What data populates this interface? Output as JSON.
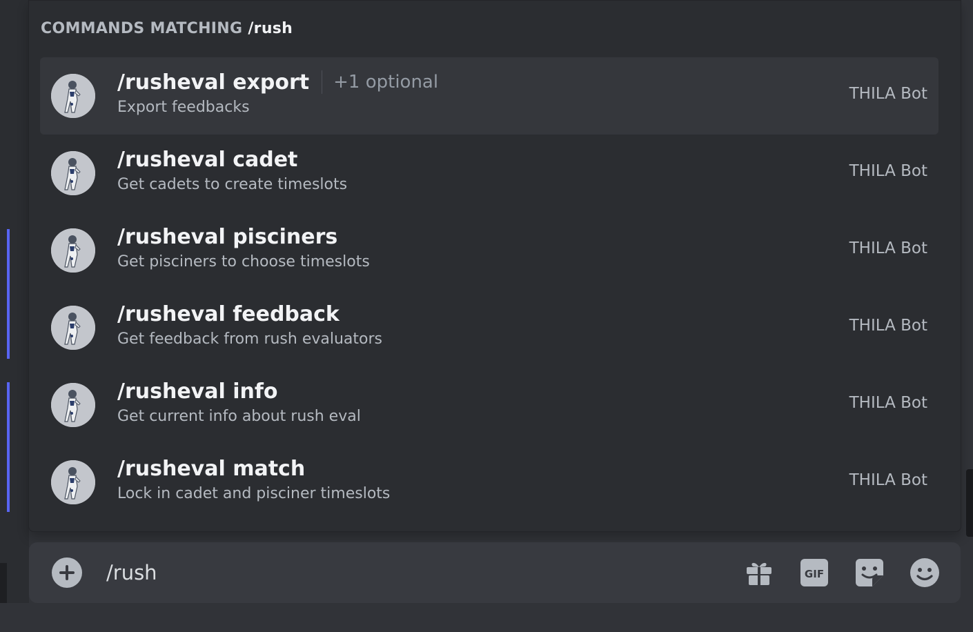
{
  "autocomplete": {
    "header_prefix": "COMMANDS MATCHING",
    "header_query": "/rush",
    "commands": [
      {
        "name": "/rusheval export",
        "optional": "+1 optional",
        "description": "Export feedbacks",
        "source": "THILA Bot"
      },
      {
        "name": "/rusheval cadet",
        "optional": "",
        "description": "Get cadets to create timeslots",
        "source": "THILA Bot"
      },
      {
        "name": "/rusheval pisciners",
        "optional": "",
        "description": "Get pisciners to choose timeslots",
        "source": "THILA Bot"
      },
      {
        "name": "/rusheval feedback",
        "optional": "",
        "description": "Get feedback from rush evaluators",
        "source": "THILA Bot"
      },
      {
        "name": "/rusheval info",
        "optional": "",
        "description": "Get current info about rush eval",
        "source": "THILA Bot"
      },
      {
        "name": "/rusheval match",
        "optional": "",
        "description": "Lock in cadet and pisciner timeslots",
        "source": "THILA Bot"
      }
    ]
  },
  "composer": {
    "value": "/rush",
    "icons": {
      "attach": "plus-circle-icon",
      "gift": "gift-icon",
      "gif": "gif-icon",
      "sticker": "sticker-icon",
      "emoji": "emoji-icon"
    }
  },
  "colors": {
    "background": "#313338",
    "popup": "#2b2d31",
    "selected_row": "#35373c",
    "composer": "#383a40",
    "accent": "#5865f2"
  }
}
